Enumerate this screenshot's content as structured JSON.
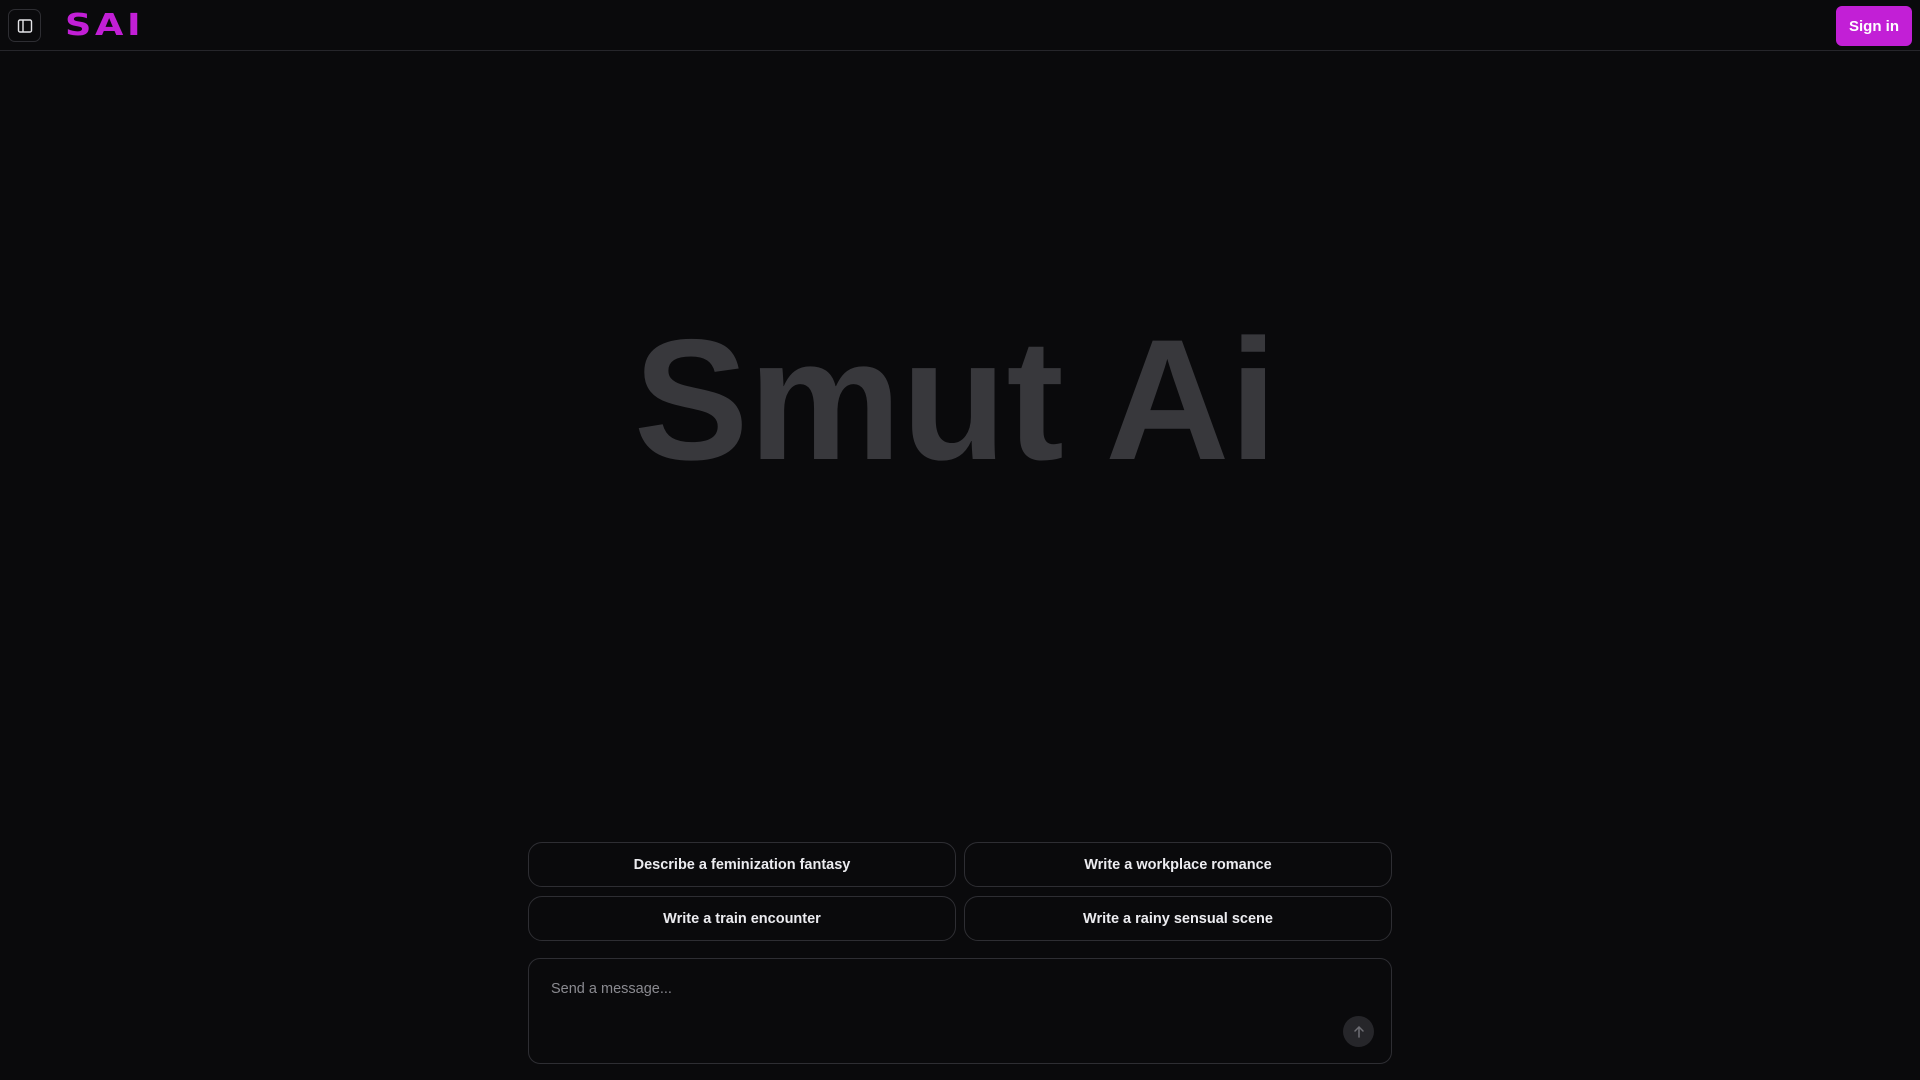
{
  "header": {
    "logo_text": "SAI",
    "sign_in_label": "Sign in",
    "sidebar_toggle_icon": "sidebar-panel-icon",
    "accent_color": "#c21fd6"
  },
  "hero": {
    "title": "Smut Ai"
  },
  "suggestions": [
    {
      "label": "Describe a feminization fantasy"
    },
    {
      "label": "Write a workplace romance"
    },
    {
      "label": "Write a train encounter"
    },
    {
      "label": "Write a rainy sensual scene"
    }
  ],
  "composer": {
    "placeholder": "Send a message...",
    "value": "",
    "send_icon": "arrow-up-icon"
  }
}
